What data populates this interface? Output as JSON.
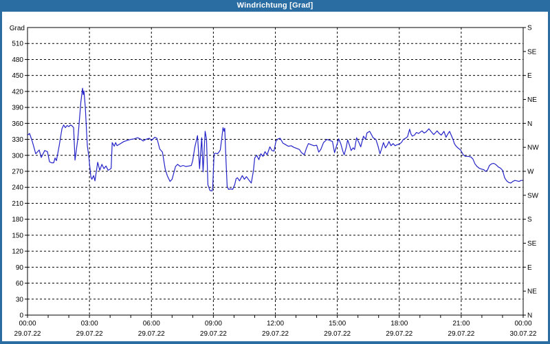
{
  "window": {
    "title": "Windrichtung [Grad]"
  },
  "colors": {
    "titlebar_bg": "#2a6da3",
    "titlebar_text": "#ffffff",
    "outer_border": "#2a6da3",
    "plot_border": "#000000",
    "grid": "#000000",
    "line": "#2222c8",
    "text": "#000000",
    "plot_bg": "#ffffff"
  },
  "chart_data": {
    "type": "line",
    "title": "Windrichtung [Grad]",
    "ylabel": "Grad",
    "grid": "dashed",
    "legend": "none",
    "y_axis_left": {
      "label": "Grad",
      "range": [
        0,
        540
      ],
      "tick_step": 30,
      "ticks": [
        0,
        30,
        60,
        90,
        120,
        150,
        180,
        210,
        240,
        270,
        300,
        330,
        360,
        390,
        420,
        450,
        480,
        510
      ]
    },
    "y_axis_right": {
      "range": [
        0,
        540
      ],
      "tick_step": 45,
      "ticks": [
        {
          "deg": 0,
          "label": "N"
        },
        {
          "deg": 45,
          "label": "NE"
        },
        {
          "deg": 90,
          "label": "E"
        },
        {
          "deg": 135,
          "label": "SE"
        },
        {
          "deg": 180,
          "label": "S"
        },
        {
          "deg": 225,
          "label": "SW"
        },
        {
          "deg": 270,
          "label": "W"
        },
        {
          "deg": 315,
          "label": "NW"
        },
        {
          "deg": 360,
          "label": "N"
        },
        {
          "deg": 405,
          "label": "NE"
        },
        {
          "deg": 450,
          "label": "E"
        },
        {
          "deg": 495,
          "label": "SE"
        },
        {
          "deg": 540,
          "label": "S"
        }
      ]
    },
    "x_axis": {
      "range_minutes": [
        0,
        1440
      ],
      "minor_tick_minutes": 60,
      "major_ticks": [
        {
          "minutes": 0,
          "time": "00:00",
          "date": "29.07.22"
        },
        {
          "minutes": 180,
          "time": "03:00",
          "date": "29.07.22"
        },
        {
          "minutes": 360,
          "time": "06:00",
          "date": "29.07.22"
        },
        {
          "minutes": 540,
          "time": "09:00",
          "date": "29.07.22"
        },
        {
          "minutes": 720,
          "time": "12:00",
          "date": "29.07.22"
        },
        {
          "minutes": 900,
          "time": "15:00",
          "date": "29.07.22"
        },
        {
          "minutes": 1080,
          "time": "18:00",
          "date": "29.07.22"
        },
        {
          "minutes": 1260,
          "time": "21:00",
          "date": "29.07.22"
        },
        {
          "minutes": 1440,
          "time": "00:00",
          "date": "30.07.22"
        }
      ]
    },
    "series": [
      {
        "name": "Windrichtung",
        "unit": "Grad",
        "points": [
          [
            0,
            338
          ],
          [
            6,
            341
          ],
          [
            14,
            326
          ],
          [
            24,
            303
          ],
          [
            34,
            310
          ],
          [
            40,
            296
          ],
          [
            50,
            309
          ],
          [
            58,
            307
          ],
          [
            64,
            288
          ],
          [
            70,
            286
          ],
          [
            76,
            286
          ],
          [
            80,
            295
          ],
          [
            84,
            290
          ],
          [
            92,
            318
          ],
          [
            100,
            350
          ],
          [
            105,
            357
          ],
          [
            110,
            352
          ],
          [
            115,
            356
          ],
          [
            120,
            354
          ],
          [
            125,
            357
          ],
          [
            130,
            355
          ],
          [
            134,
            352
          ],
          [
            138,
            291
          ],
          [
            146,
            330
          ],
          [
            150,
            360
          ],
          [
            155,
            400
          ],
          [
            160,
            426
          ],
          [
            162,
            414
          ],
          [
            164,
            421
          ],
          [
            168,
            390
          ],
          [
            172,
            340
          ],
          [
            174,
            317
          ],
          [
            178,
            299
          ],
          [
            184,
            260
          ],
          [
            187,
            255
          ],
          [
            192,
            262
          ],
          [
            196,
            252
          ],
          [
            204,
            287
          ],
          [
            210,
            272
          ],
          [
            216,
            283
          ],
          [
            222,
            275
          ],
          [
            228,
            280
          ],
          [
            234,
            272
          ],
          [
            240,
            274
          ],
          [
            243,
            276
          ],
          [
            246,
            324
          ],
          [
            252,
            317
          ],
          [
            256,
            324
          ],
          [
            260,
            318
          ],
          [
            270,
            322
          ],
          [
            280,
            326
          ],
          [
            290,
            328
          ],
          [
            300,
            330
          ],
          [
            310,
            331
          ],
          [
            320,
            333
          ],
          [
            330,
            330
          ],
          [
            336,
            327
          ],
          [
            344,
            330
          ],
          [
            354,
            332
          ],
          [
            360,
            328
          ],
          [
            370,
            334
          ],
          [
            376,
            332
          ],
          [
            384,
            312
          ],
          [
            392,
            306
          ],
          [
            400,
            274
          ],
          [
            406,
            262
          ],
          [
            414,
            251
          ],
          [
            420,
            255
          ],
          [
            430,
            279
          ],
          [
            436,
            283
          ],
          [
            444,
            279
          ],
          [
            452,
            281
          ],
          [
            460,
            279
          ],
          [
            468,
            280
          ],
          [
            476,
            281
          ],
          [
            480,
            290
          ],
          [
            486,
            315
          ],
          [
            494,
            337
          ],
          [
            500,
            275
          ],
          [
            506,
            333
          ],
          [
            510,
            269
          ],
          [
            516,
            345
          ],
          [
            520,
            330
          ],
          [
            524,
            245
          ],
          [
            530,
            234
          ],
          [
            536,
            233
          ],
          [
            538,
            240
          ],
          [
            542,
            303
          ],
          [
            546,
            304
          ],
          [
            552,
            303
          ],
          [
            556,
            306
          ],
          [
            560,
            310
          ],
          [
            564,
            330
          ],
          [
            568,
            352
          ],
          [
            571,
            345
          ],
          [
            573,
            351
          ],
          [
            576,
            300
          ],
          [
            580,
            242
          ],
          [
            584,
            236
          ],
          [
            590,
            237
          ],
          [
            596,
            236
          ],
          [
            602,
            245
          ],
          [
            606,
            256
          ],
          [
            610,
            258
          ],
          [
            616,
            252
          ],
          [
            624,
            262
          ],
          [
            630,
            255
          ],
          [
            636,
            260
          ],
          [
            644,
            253
          ],
          [
            650,
            248
          ],
          [
            656,
            270
          ],
          [
            660,
            295
          ],
          [
            666,
            300
          ],
          [
            672,
            292
          ],
          [
            678,
            303
          ],
          [
            684,
            298
          ],
          [
            690,
            307
          ],
          [
            696,
            301
          ],
          [
            704,
            316
          ],
          [
            710,
            309
          ],
          [
            716,
            308
          ],
          [
            722,
            327
          ],
          [
            728,
            331
          ],
          [
            734,
            332
          ],
          [
            742,
            323
          ],
          [
            750,
            320
          ],
          [
            758,
            317
          ],
          [
            766,
            318
          ],
          [
            774,
            315
          ],
          [
            782,
            313
          ],
          [
            790,
            311
          ],
          [
            796,
            305
          ],
          [
            804,
            301
          ],
          [
            810,
            313
          ],
          [
            816,
            322
          ],
          [
            824,
            320
          ],
          [
            832,
            318
          ],
          [
            840,
            319
          ],
          [
            846,
            306
          ],
          [
            852,
            311
          ],
          [
            860,
            324
          ],
          [
            870,
            330
          ],
          [
            878,
            328
          ],
          [
            886,
            326
          ],
          [
            892,
            305
          ],
          [
            898,
            318
          ],
          [
            904,
            331
          ],
          [
            910,
            322
          ],
          [
            916,
            308
          ],
          [
            920,
            301
          ],
          [
            926,
            315
          ],
          [
            930,
            329
          ],
          [
            936,
            318
          ],
          [
            940,
            309
          ],
          [
            946,
            314
          ],
          [
            950,
            311
          ],
          [
            956,
            333
          ],
          [
            962,
            325
          ],
          [
            968,
            316
          ],
          [
            976,
            336
          ],
          [
            982,
            330
          ],
          [
            986,
            342
          ],
          [
            994,
            345
          ],
          [
            1000,
            338
          ],
          [
            1004,
            333
          ],
          [
            1012,
            330
          ],
          [
            1018,
            318
          ],
          [
            1024,
            303
          ],
          [
            1030,
            315
          ],
          [
            1034,
            324
          ],
          [
            1040,
            314
          ],
          [
            1046,
            320
          ],
          [
            1050,
            326
          ],
          [
            1056,
            318
          ],
          [
            1062,
            322
          ],
          [
            1068,
            318
          ],
          [
            1074,
            320
          ],
          [
            1080,
            321
          ],
          [
            1086,
            324
          ],
          [
            1092,
            330
          ],
          [
            1098,
            332
          ],
          [
            1104,
            335
          ],
          [
            1110,
            349
          ],
          [
            1114,
            340
          ],
          [
            1118,
            336
          ],
          [
            1124,
            338
          ],
          [
            1130,
            343
          ],
          [
            1136,
            341
          ],
          [
            1142,
            344
          ],
          [
            1146,
            346
          ],
          [
            1152,
            342
          ],
          [
            1158,
            344
          ],
          [
            1166,
            350
          ],
          [
            1172,
            345
          ],
          [
            1180,
            339
          ],
          [
            1186,
            343
          ],
          [
            1190,
            346
          ],
          [
            1196,
            341
          ],
          [
            1202,
            338
          ],
          [
            1210,
            345
          ],
          [
            1216,
            334
          ],
          [
            1222,
            341
          ],
          [
            1226,
            345
          ],
          [
            1232,
            336
          ],
          [
            1236,
            330
          ],
          [
            1240,
            322
          ],
          [
            1244,
            318
          ],
          [
            1250,
            314
          ],
          [
            1258,
            310
          ],
          [
            1266,
            301
          ],
          [
            1272,
            298
          ],
          [
            1280,
            298
          ],
          [
            1288,
            297
          ],
          [
            1294,
            293
          ],
          [
            1300,
            284
          ],
          [
            1306,
            279
          ],
          [
            1312,
            276
          ],
          [
            1320,
            274
          ],
          [
            1326,
            273
          ],
          [
            1330,
            270
          ],
          [
            1336,
            272
          ],
          [
            1342,
            281
          ],
          [
            1348,
            284
          ],
          [
            1354,
            285
          ],
          [
            1360,
            283
          ],
          [
            1368,
            278
          ],
          [
            1374,
            276
          ],
          [
            1380,
            272
          ],
          [
            1386,
            258
          ],
          [
            1392,
            252
          ],
          [
            1398,
            249
          ],
          [
            1404,
            248
          ],
          [
            1410,
            251
          ],
          [
            1416,
            253
          ],
          [
            1422,
            252
          ],
          [
            1428,
            251
          ],
          [
            1434,
            253
          ],
          [
            1439,
            253
          ]
        ]
      }
    ]
  }
}
